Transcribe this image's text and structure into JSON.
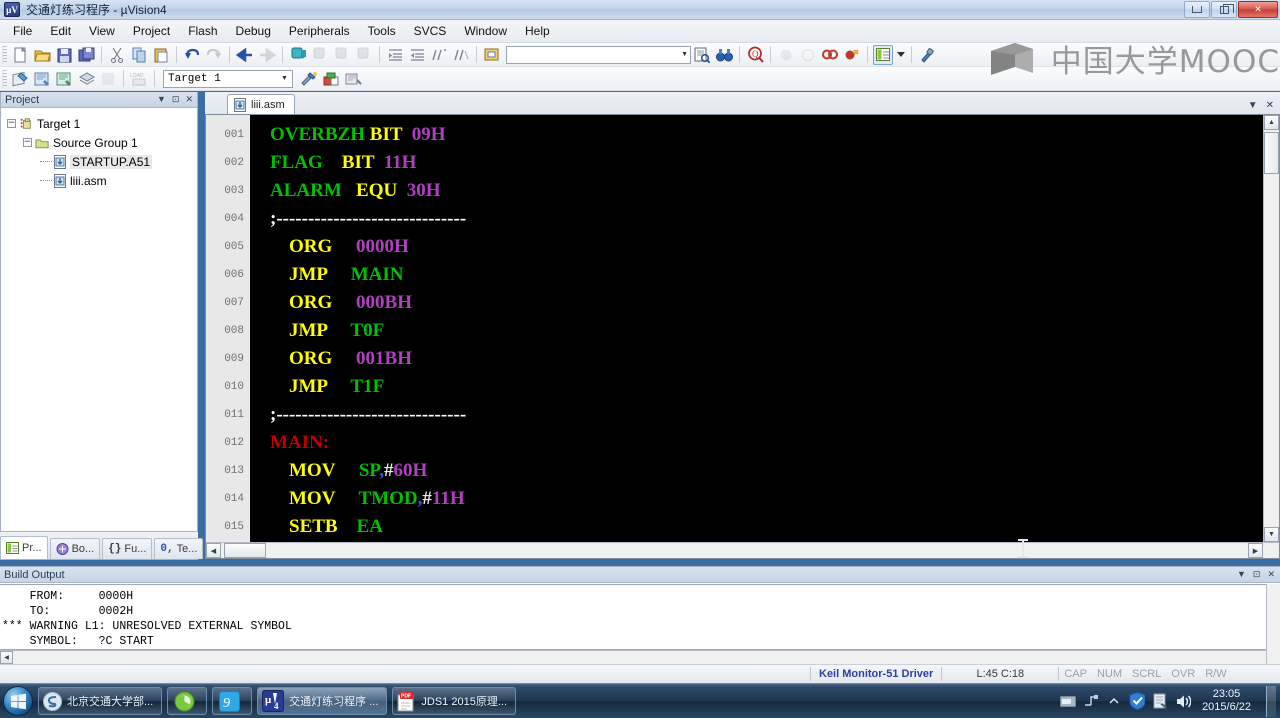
{
  "window": {
    "title": "交通灯练习程序  - µVision4",
    "app_icon_label": "µV",
    "minimize_label": "Minimize",
    "maximize_label": "Maximize",
    "close_label": "Close"
  },
  "menubar": {
    "items": [
      {
        "label": "File"
      },
      {
        "label": "Edit"
      },
      {
        "label": "View"
      },
      {
        "label": "Project"
      },
      {
        "label": "Flash"
      },
      {
        "label": "Debug"
      },
      {
        "label": "Peripherals"
      },
      {
        "label": "Tools"
      },
      {
        "label": "SVCS"
      },
      {
        "label": "Window"
      },
      {
        "label": "Help"
      }
    ]
  },
  "toolbar2": {
    "target_value": "Target 1",
    "find_value": "",
    "find_placeholder": ""
  },
  "watermark": {
    "text": "中国大学MOOC"
  },
  "project_panel": {
    "caption": "Project",
    "tree": {
      "target": "Target 1",
      "group": "Source Group 1",
      "files": [
        "STARTUP.A51",
        "liii.asm"
      ]
    },
    "tabs": [
      {
        "label": "Pr...",
        "icon": "project-icon"
      },
      {
        "label": "Bo...",
        "icon": "books-icon"
      },
      {
        "label": "Fu...",
        "icon": "functions-icon"
      },
      {
        "label": "Te...",
        "icon": "templates-icon"
      }
    ]
  },
  "editor": {
    "tab_label": "liii.asm",
    "lines": [
      {
        "num": "001",
        "tokens": [
          {
            "t": "OVERBZH",
            "c": "c-label"
          },
          {
            "t": " ",
            "c": ""
          },
          {
            "t": "BIT",
            "c": "c-dir"
          },
          {
            "t": "  ",
            "c": ""
          },
          {
            "t": "09H",
            "c": "c-num"
          }
        ]
      },
      {
        "num": "002",
        "tokens": [
          {
            "t": "FLAG",
            "c": "c-label"
          },
          {
            "t": "    ",
            "c": ""
          },
          {
            "t": "BIT",
            "c": "c-dir"
          },
          {
            "t": "  ",
            "c": ""
          },
          {
            "t": "11H",
            "c": "c-num"
          }
        ]
      },
      {
        "num": "003",
        "tokens": [
          {
            "t": "ALARM",
            "c": "c-label"
          },
          {
            "t": "   ",
            "c": ""
          },
          {
            "t": "EQU",
            "c": "c-dir"
          },
          {
            "t": "  ",
            "c": ""
          },
          {
            "t": "30H",
            "c": "c-num"
          }
        ]
      },
      {
        "num": "004",
        "tokens": [
          {
            "t": ";------------------------------",
            "c": "c-cmt"
          }
        ]
      },
      {
        "num": "005",
        "tokens": [
          {
            "t": "    ",
            "c": ""
          },
          {
            "t": "ORG",
            "c": "c-dir"
          },
          {
            "t": "     ",
            "c": ""
          },
          {
            "t": "0000H",
            "c": "c-num"
          }
        ]
      },
      {
        "num": "006",
        "tokens": [
          {
            "t": "    ",
            "c": ""
          },
          {
            "t": "JMP",
            "c": "c-dir"
          },
          {
            "t": "     ",
            "c": ""
          },
          {
            "t": "MAIN",
            "c": "c-sym"
          }
        ]
      },
      {
        "num": "007",
        "tokens": [
          {
            "t": "    ",
            "c": ""
          },
          {
            "t": "ORG",
            "c": "c-dir"
          },
          {
            "t": "     ",
            "c": ""
          },
          {
            "t": "000BH",
            "c": "c-num"
          }
        ]
      },
      {
        "num": "008",
        "tokens": [
          {
            "t": "    ",
            "c": ""
          },
          {
            "t": "JMP",
            "c": "c-dir"
          },
          {
            "t": "     ",
            "c": ""
          },
          {
            "t": "T0F",
            "c": "c-sym"
          }
        ]
      },
      {
        "num": "009",
        "tokens": [
          {
            "t": "    ",
            "c": ""
          },
          {
            "t": "ORG",
            "c": "c-dir"
          },
          {
            "t": "     ",
            "c": ""
          },
          {
            "t": "001BH",
            "c": "c-num"
          }
        ]
      },
      {
        "num": "010",
        "tokens": [
          {
            "t": "    ",
            "c": ""
          },
          {
            "t": "JMP",
            "c": "c-dir"
          },
          {
            "t": "     ",
            "c": ""
          },
          {
            "t": "T1F",
            "c": "c-sym"
          }
        ]
      },
      {
        "num": "011",
        "tokens": [
          {
            "t": ";------------------------------",
            "c": "c-cmt"
          }
        ]
      },
      {
        "num": "012",
        "tokens": [
          {
            "t": "MAIN:",
            "c": "c-red"
          }
        ]
      },
      {
        "num": "013",
        "tokens": [
          {
            "t": "    ",
            "c": ""
          },
          {
            "t": "MOV",
            "c": "c-dir"
          },
          {
            "t": "     ",
            "c": ""
          },
          {
            "t": "SP",
            "c": "c-sym"
          },
          {
            "t": ",",
            "c": "c-punc"
          },
          {
            "t": "#",
            "c": "c-hash"
          },
          {
            "t": "60H",
            "c": "c-num"
          }
        ]
      },
      {
        "num": "014",
        "tokens": [
          {
            "t": "    ",
            "c": ""
          },
          {
            "t": "MOV",
            "c": "c-dir"
          },
          {
            "t": "     ",
            "c": ""
          },
          {
            "t": "TMOD",
            "c": "c-sym"
          },
          {
            "t": ",",
            "c": "c-punc"
          },
          {
            "t": "#",
            "c": "c-hash"
          },
          {
            "t": "11H",
            "c": "c-num"
          }
        ]
      },
      {
        "num": "015",
        "tokens": [
          {
            "t": "    ",
            "c": ""
          },
          {
            "t": "SETB",
            "c": "c-dir"
          },
          {
            "t": "    ",
            "c": ""
          },
          {
            "t": "EA",
            "c": "c-sym"
          }
        ]
      }
    ]
  },
  "build_output": {
    "caption": "Build Output",
    "lines": [
      "    FROM:     0000H",
      "    TO:       0002H",
      "*** WARNING L1: UNRESOLVED EXTERNAL SYMBOL",
      "    SYMBOL:   ?C START"
    ]
  },
  "statusbar": {
    "driver": "Keil Monitor-51 Driver",
    "position": "L:45 C:18",
    "flags": [
      "CAP",
      "NUM",
      "SCRL",
      "OVR",
      "R/W"
    ]
  },
  "taskbar": {
    "buttons": [
      {
        "label": "北京交通大学部...",
        "icon": "sogou-icon"
      },
      {
        "label": "",
        "icon": "browser-icon"
      },
      {
        "label": "",
        "icon": "qq-icon"
      },
      {
        "label": "交通灯练习程序 ...",
        "icon": "uvision-icon"
      },
      {
        "label": "JDS1 2015原理...",
        "icon": "pdf-icon"
      }
    ],
    "clock_time": "23:05",
    "clock_date": "2015/6/22"
  }
}
